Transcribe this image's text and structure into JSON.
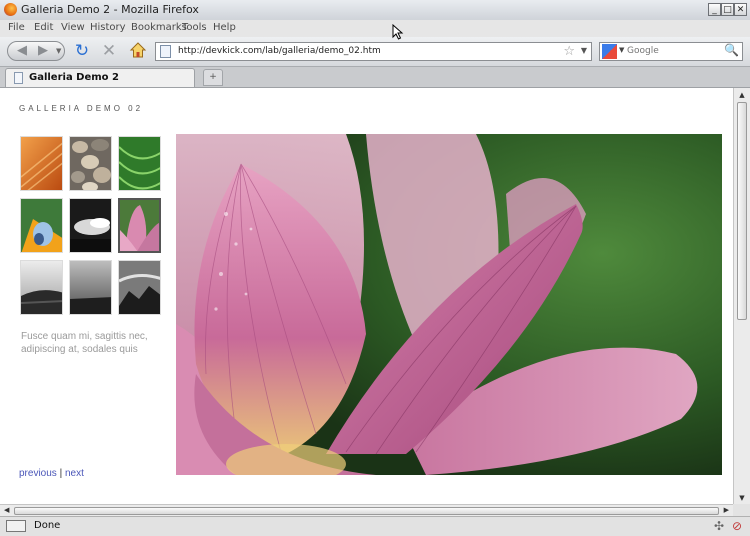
{
  "window": {
    "title": "Galleria Demo 2 - Mozilla Firefox",
    "minimize": "_",
    "maximize": "□",
    "close": "✕"
  },
  "menu": [
    "File",
    "Edit",
    "View",
    "History",
    "Bookmarks",
    "Tools",
    "Help"
  ],
  "nav": {
    "back_icon": "◀",
    "forward_icon": "▶",
    "reload_icon": "↻",
    "stop_icon": "✕",
    "url": "http://devkick.com/lab/galleria/demo_02.htm",
    "star_icon": "☆",
    "dropdown_icon": "▼",
    "search_placeholder": "Google",
    "search_engine_dropdown": "▼",
    "search_icon": "🔍"
  },
  "tabs": [
    {
      "label": "Galleria Demo 2",
      "active": true
    }
  ],
  "new_tab_icon": "+",
  "gallery": {
    "title": "GALLERIA DEMO 02",
    "caption": "Fusce quam mi, sagittis nec, adipiscing at, sodales quis",
    "prev_label": "previous",
    "sep": "|",
    "next_label": "next",
    "thumbnails": [
      {
        "name": "thumb-orange-leaf"
      },
      {
        "name": "thumb-pebbles"
      },
      {
        "name": "thumb-green-grass"
      },
      {
        "name": "thumb-yellow-flower"
      },
      {
        "name": "thumb-dark-clouds"
      },
      {
        "name": "thumb-pink-lotus",
        "active": true
      },
      {
        "name": "thumb-bw-landscape"
      },
      {
        "name": "thumb-bw-sky"
      },
      {
        "name": "thumb-bw-rocks"
      }
    ]
  },
  "scrollbar": {
    "up": "▲",
    "down": "▼",
    "left": "◀",
    "right": "▶"
  },
  "status": {
    "text": "Done"
  }
}
